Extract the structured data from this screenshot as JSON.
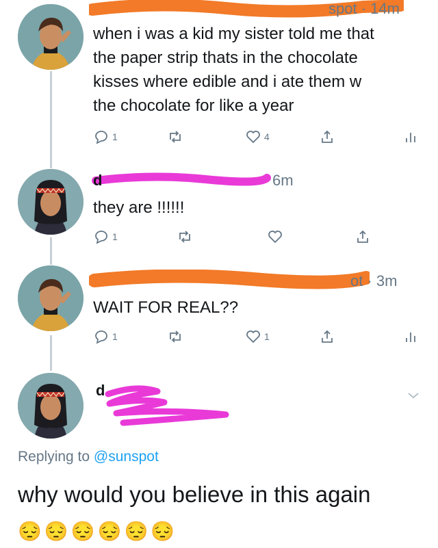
{
  "tweets": [
    {
      "meta_time": "spot · 14m",
      "text_lines": [
        "when i was a kid my sister told me that",
        "the paper strip thats in the chocolate",
        "kisses where edible and i ate them w",
        "the chocolate for like a year"
      ],
      "actions": {
        "reply": "1",
        "retweet": "",
        "like": "4"
      }
    },
    {
      "meta_name": "d",
      "meta_time": "6m",
      "text": "they are !!!!!!",
      "actions": {
        "reply": "1",
        "retweet": "",
        "like": ""
      }
    },
    {
      "meta_time": "ot · 3m",
      "text": "WAIT FOR REAL??",
      "actions": {
        "reply": "1",
        "retweet": "",
        "like": "1"
      }
    },
    {
      "meta_name": "d",
      "replying_prefix": "Replying to ",
      "replying_handle": "@sunspot",
      "text": "why would you believe in this again",
      "emojis": "😔😔😔😔😔😔"
    }
  ],
  "colors": {
    "redact_orange": "#f27a28",
    "redact_magenta": "#e93ad8",
    "link_blue": "#1da1f2",
    "muted": "#657786"
  },
  "icons": [
    "reply-icon",
    "retweet-icon",
    "like-icon",
    "share-icon",
    "analytics-icon",
    "chevron-down-icon"
  ]
}
